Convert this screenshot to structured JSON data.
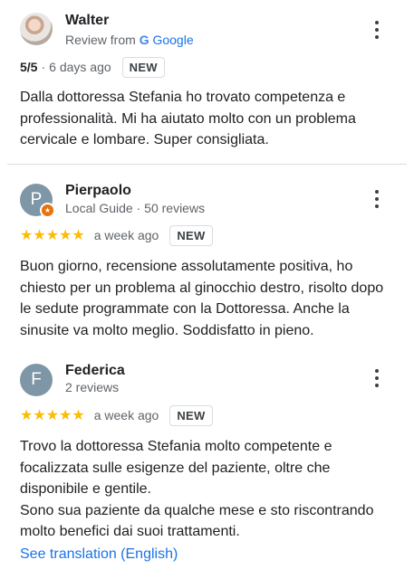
{
  "reviews": [
    {
      "name": "Walter",
      "avatar_initial": "",
      "source_prefix": "Review from",
      "source_logo_letter": "G",
      "source_name": "Google",
      "rating_text": "5/5",
      "separator": "·",
      "time": "6 days ago",
      "badge": "NEW",
      "text": "Dalla dottoressa Stefania ho trovato competenza e professionalità. Mi ha aiutato molto con un problema cervicale e lombare. Super consigliata."
    },
    {
      "name": "Pierpaolo",
      "avatar_initial": "P",
      "sub": "Local Guide · 50 reviews",
      "stars": "★★★★★",
      "rating": 5,
      "time": "a week ago",
      "badge": "NEW",
      "text": "Buon giorno, recensione assolutamente positiva, ho chiesto per un problema al ginocchio destro, risolto dopo le sedute programmate con la Dottoressa. Anche la sinusite va molto meglio. Soddisfatto in pieno."
    },
    {
      "name": "Federica",
      "avatar_initial": "F",
      "sub": "2 reviews",
      "stars": "★★★★★",
      "rating": 5,
      "time": "a week ago",
      "badge": "NEW",
      "text_lines": [
        "Trovo la dottoressa Stefania molto competente e focalizzata sulle esigenze del paziente, oltre che disponibile e gentile.",
        "Sono sua paziente da qualche mese e sto riscontrando molto benefici dai suoi trattamenti."
      ]
    }
  ],
  "see_translation": "See translation (English)",
  "colors": {
    "star": "#fbbc04",
    "link": "#1a73e8",
    "avatar_grey": "#7f96a6",
    "local_guide_badge": "#e8710a"
  },
  "icons": {
    "more": "more-vert-icon",
    "guide": "local-guide-badge-icon"
  }
}
